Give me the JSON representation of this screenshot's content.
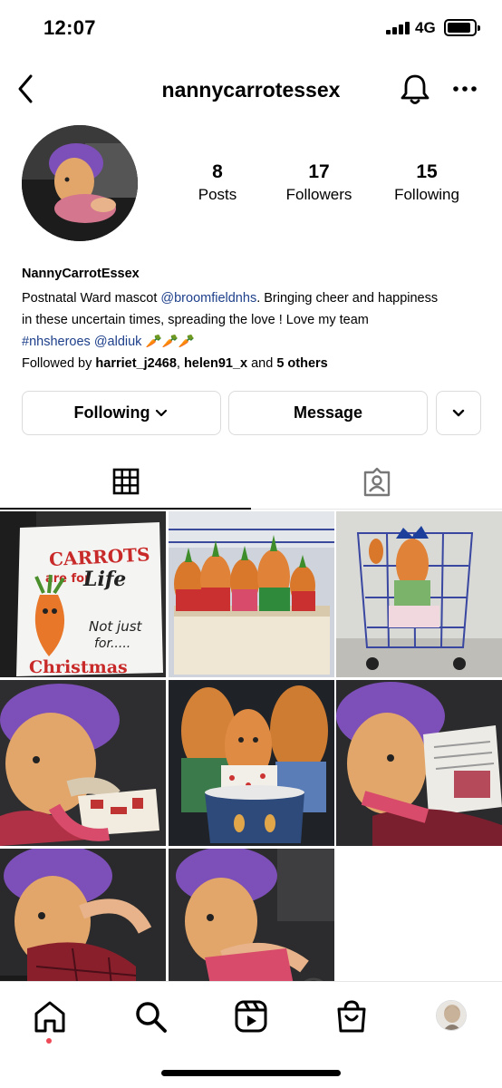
{
  "status_bar": {
    "time": "12:07",
    "network": "4G"
  },
  "top_nav": {
    "username": "nannycarrotessex"
  },
  "profile": {
    "stats": [
      {
        "value": "8",
        "label": "Posts"
      },
      {
        "value": "17",
        "label": "Followers"
      },
      {
        "value": "15",
        "label": "Following"
      }
    ],
    "display_name": "NannyCarrotEssex",
    "bio_line1_a": "Postnatal Ward mascot ",
    "bio_mention1": "@broomfieldnhs",
    "bio_line1_b": ". Bringing cheer and happiness",
    "bio_line2": "in these uncertain times, spreading the love ! Love my team",
    "bio_hashtag": "#nhsheroes",
    "bio_mention2": "@aldiuk",
    "bio_emojis": "🥕🥕🥕",
    "followed_by_prefix": "Followed by ",
    "followed_user1": "harriet_j2468",
    "followed_sep": ", ",
    "followed_user2": "helen91_x",
    "followed_and": " and ",
    "followed_others": "5 others"
  },
  "actions": {
    "following_label": "Following",
    "message_label": "Message"
  },
  "pillow_text": {
    "line1": "CARROTS",
    "line2a": "are for",
    "line2b": "Life",
    "line3": "Not just",
    "line4": "for.....",
    "line5": "Christmas"
  },
  "colors": {
    "link": "#1d3f8a",
    "notification_dot": "#ed4956",
    "border": "#dbdbdb",
    "carrot": "#d9772b",
    "hat_purple": "#7d4fb8"
  },
  "icons": {
    "back": "back-icon",
    "bell": "bell-icon",
    "more": "more-icon",
    "grid": "grid-icon",
    "tagged": "tagged-icon",
    "home": "home-icon",
    "search": "search-icon",
    "reels": "reels-icon",
    "shop": "shop-icon"
  }
}
